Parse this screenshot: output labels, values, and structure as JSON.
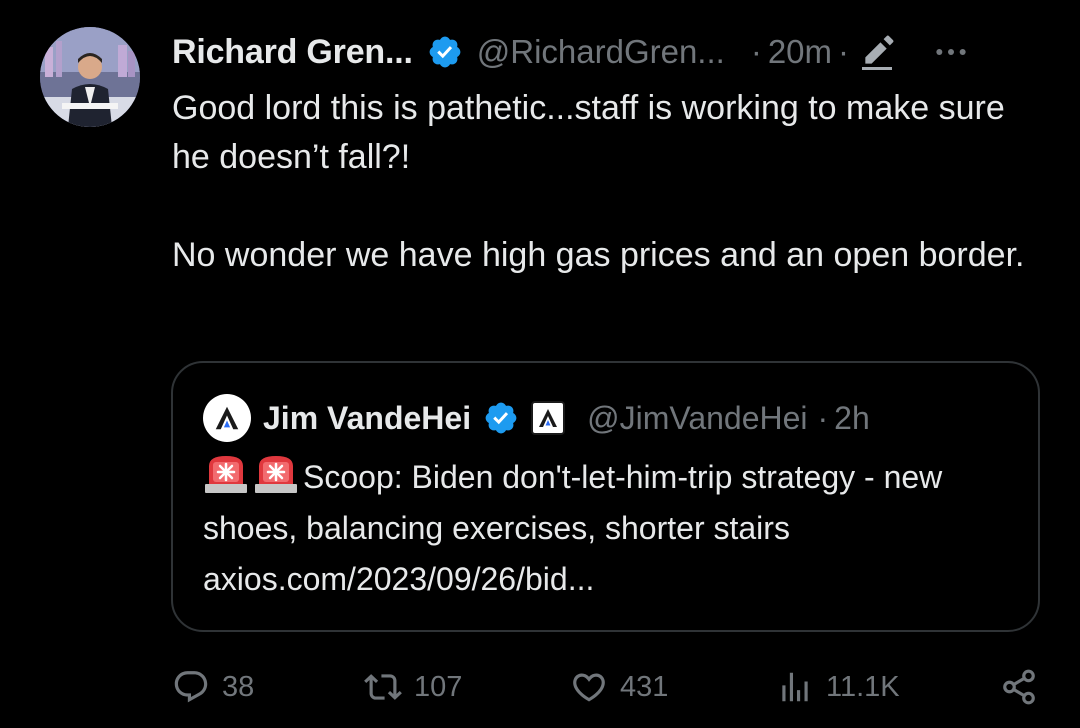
{
  "author": {
    "name": "Richard Gren...",
    "handle": "@RichardGren...",
    "separator": "·",
    "time": "20m",
    "verified_color": "#1d9bf0"
  },
  "body": {
    "text": "Good lord this is pathetic...staff is working to make sure he doesn’t fall?!\n\nNo wonder we have high gas prices and an open border."
  },
  "quote": {
    "name": "Jim VandeHei",
    "handle": "@JimVandeHei",
    "separator": "·",
    "time": "2h",
    "text_main": "Scoop: Biden don't-let-him-trip strategy - new shoes, balancing exercises, shorter stairs",
    "link": "axios.com/2023/09/26/bid...",
    "icons": [
      "siren-emoji",
      "siren-emoji"
    ]
  },
  "actions": {
    "replies": "38",
    "reposts": "107",
    "likes": "431",
    "views": "11.1K"
  },
  "colors": {
    "background": "#000000",
    "text": "#e7e9ea",
    "muted": "#71767b",
    "border": "#2f3336",
    "accent": "#1d9bf0"
  }
}
